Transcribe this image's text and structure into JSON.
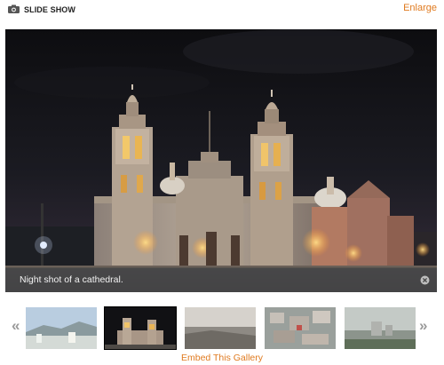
{
  "header": {
    "title": "SLIDE SHOW",
    "enlarge_label": "Enlarge"
  },
  "viewer": {
    "caption": "Night shot of a cathedral."
  },
  "thumbnails": {
    "prev_label": "«",
    "next_label": "»",
    "active_index": 1
  },
  "footer": {
    "embed_label": "Embed This Gallery"
  },
  "colors": {
    "accent": "#e07a1f",
    "caption_bar": "#464648"
  }
}
